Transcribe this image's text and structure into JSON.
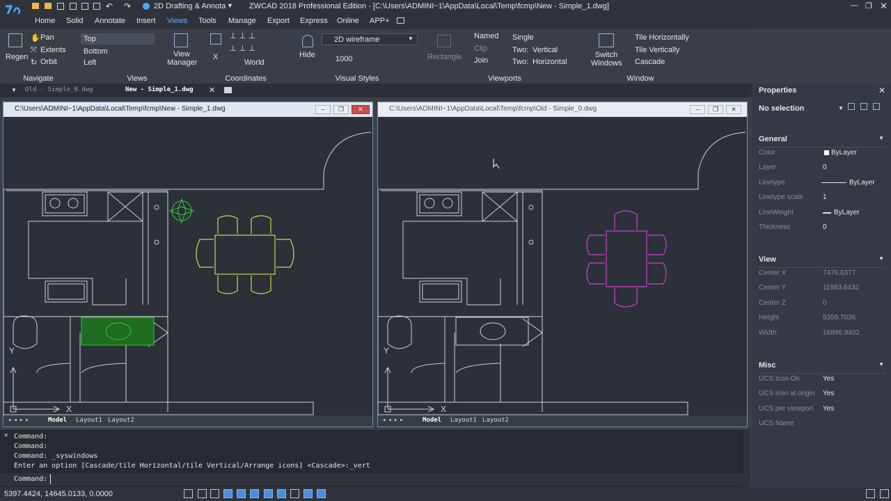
{
  "app": {
    "title": "ZWCAD 2018 Professional Edition - [C:\\Users\\ADMINI~1\\AppData\\Local\\Temp\\fcmp\\New - Simple_1.dwg]",
    "workspace": "2D Drafting & Annota",
    "logo_icon": "zwcad-logo-icon"
  },
  "ribbon": {
    "tabs": [
      "Home",
      "Solid",
      "Annotate",
      "Insert",
      "Views",
      "Tools",
      "Manage",
      "Export",
      "Express",
      "Online",
      "APP+"
    ],
    "active_tab": "Views",
    "panels": {
      "navigate": {
        "label": "Navigate",
        "regen": "Regen",
        "pan": "Pan",
        "extents": "Extents",
        "orbit": "Orbit"
      },
      "views": {
        "label": "Views",
        "items": [
          "Top",
          "Bottom",
          "Left"
        ],
        "view_manager": "View Manager"
      },
      "coordinates": {
        "label": "Coordinates",
        "world": "World",
        "x": "X"
      },
      "visual_styles": {
        "label": "Visual Styles",
        "hide": "Hide",
        "style": "2D wireframe",
        "value": "1000"
      },
      "viewports": {
        "label": "Viewports",
        "rectangle": "Rectangle",
        "named": "Named",
        "clip": "Clip",
        "join": "Join",
        "single": "Single",
        "two_vertical": "Two:",
        "vertical": "Vertical",
        "two_horizontal": "Two:",
        "horizontal": "Horizontal"
      },
      "window": {
        "label": "Window",
        "switch_windows": "Switch Windows",
        "tile_h": "Tile Horizontally",
        "tile_v": "Tile Vertically",
        "cascade": "Cascade"
      }
    }
  },
  "doc_tabs": [
    {
      "label": "Old - Simple_0.dwg",
      "active": false
    },
    {
      "label": "New - Simple_1.dwg",
      "active": true
    }
  ],
  "windows": [
    {
      "caption": "C:\\Users\\ADMINI~1\\AppData\\Local\\Temp\\fcmp\\New - Simple_1.dwg",
      "layout_tabs": [
        "Model",
        "Layout1",
        "Layout2"
      ]
    },
    {
      "caption": "C:\\Users\\ADMINI~1\\AppData\\Local\\Temp\\fcmp\\Old - Simple_0.dwg",
      "layout_tabs": [
        "Model",
        "Layout1",
        "Layout2"
      ]
    }
  ],
  "drawing": {
    "ucs_y": "Y",
    "ucs_x": "X"
  },
  "properties": {
    "title": "Properties",
    "selection": "No selection",
    "general": {
      "label": "General",
      "rows": [
        {
          "k": "Color",
          "v": "ByLayer"
        },
        {
          "k": "Layer",
          "v": "0"
        },
        {
          "k": "Linetype",
          "v": "ByLayer"
        },
        {
          "k": "Linetype scale",
          "v": "1"
        },
        {
          "k": "LineWeight",
          "v": "ByLayer"
        },
        {
          "k": "Thickness",
          "v": "0"
        }
      ]
    },
    "view": {
      "label": "View",
      "rows": [
        {
          "k": "Center X",
          "v": "7476.6377"
        },
        {
          "k": "Center Y",
          "v": "11983.6432"
        },
        {
          "k": "Center Z",
          "v": "0"
        },
        {
          "k": "Height",
          "v": "5359.7036"
        },
        {
          "k": "Width",
          "v": "16896.9402"
        }
      ]
    },
    "misc": {
      "label": "Misc",
      "rows": [
        {
          "k": "UCS Icon On",
          "v": "Yes"
        },
        {
          "k": "UCS icon at origin",
          "v": "Yes"
        },
        {
          "k": "UCS per viewport",
          "v": "Yes"
        },
        {
          "k": "UCS Name",
          "v": ""
        }
      ]
    }
  },
  "command": {
    "history": [
      "Command:",
      "Command:",
      "Command: _syswindows",
      "Enter an option [Cascade/tile Horizontal/tile Vertical/Arrange icons] <Cascade>:_vert"
    ],
    "prompt": "Command:"
  },
  "status": {
    "coords": "5397.4424, 14645.0133, 0.0000"
  },
  "colors": {
    "accent": "#5fb0ff",
    "new_dining": "#d6d84a",
    "old_dining": "#d13fd1",
    "plant": "#2fd12f"
  }
}
